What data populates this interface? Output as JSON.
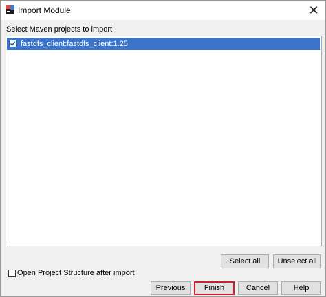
{
  "window": {
    "title": "Import Module",
    "close_glyph": "✕",
    "icon": "intellij-app-icon"
  },
  "section": {
    "label": "Select Maven projects to import"
  },
  "projects": [
    {
      "label": "fastdfs_client:fastdfs_client:1.25",
      "checked": true,
      "selected": true
    }
  ],
  "list_actions": {
    "select_all": "Select all",
    "unselect_all": "Unselect all"
  },
  "options": {
    "open_structure_first": "O",
    "open_structure_rest": "pen Project Structure after import",
    "open_structure_checked": false
  },
  "footer": {
    "previous": "Previous",
    "finish": "Finish",
    "cancel": "Cancel",
    "help": "Help"
  },
  "colors": {
    "selection": "#3b74c8",
    "finish_highlight": "#d21e2e",
    "dialog_background": "#f0f0f0"
  }
}
